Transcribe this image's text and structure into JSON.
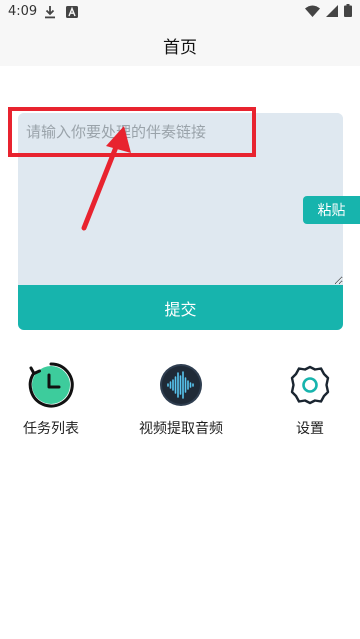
{
  "status_bar": {
    "time": "4:09",
    "left_icons": [
      "download-icon",
      "a-notification-icon"
    ],
    "right_icons": [
      "wifi-icon",
      "cell-signal-icon",
      "battery-icon"
    ]
  },
  "header": {
    "title": "首页"
  },
  "link_input": {
    "placeholder": "请输入你要处理的伴奏链接",
    "value": ""
  },
  "paste_button": {
    "label": "粘贴"
  },
  "submit_button": {
    "label": "提交"
  },
  "features": [
    {
      "label": "任务列表",
      "icon": "task-clock-icon"
    },
    {
      "label": "视频提取音频",
      "icon": "audio-waveform-icon"
    },
    {
      "label": "设置",
      "icon": "gear-icon"
    }
  ],
  "colors": {
    "accent": "#17b4ad",
    "input_bg": "#dfe8f0",
    "annotation": "#e8232f"
  }
}
